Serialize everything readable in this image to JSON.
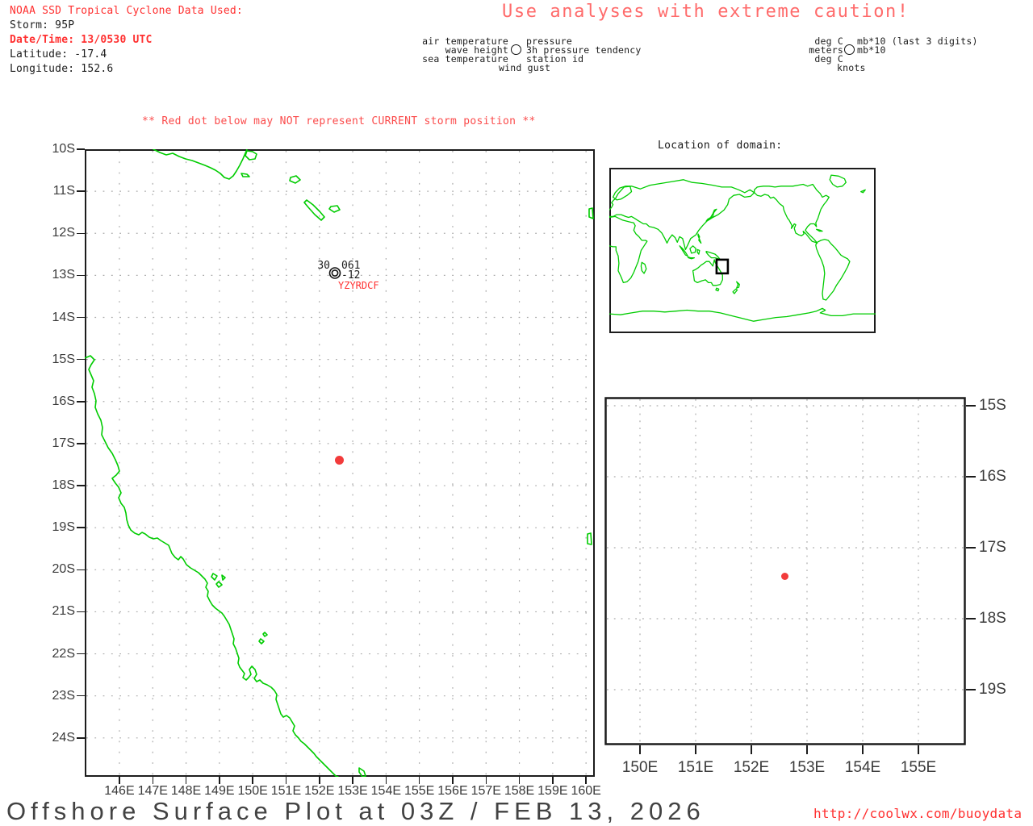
{
  "header": {
    "noaa_line": "NOAA SSD Tropical Cyclone Data Used:",
    "storm": "Storm: 95P",
    "datetime": "Date/Time: 13/0530 UTC",
    "latitude": "Latitude: -17.4",
    "longitude": "Longitude: 152.6",
    "caution": "Use analyses with extreme caution!"
  },
  "station_legend": {
    "air_temperature": "air temperature",
    "wave_height": "wave height",
    "sea_temperature": "sea temperature",
    "wind_gust": "wind gust",
    "pressure": "pressure",
    "pressure_tendency": "3h pressure tendency",
    "station_id": "station id"
  },
  "units_legend": {
    "air_temperature": "deg C",
    "wave_height": "meters",
    "sea_temperature": "deg C",
    "wind_gust": "knots",
    "pressure": "mb*10 (last 3 digits)",
    "pressure_tendency": "mb*10"
  },
  "warning": "** Red dot below may NOT represent CURRENT storm position **",
  "inset": {
    "title": "Location of domain:"
  },
  "main_map": {
    "lat_labels": [
      "10S",
      "11S",
      "12S",
      "13S",
      "14S",
      "15S",
      "16S",
      "17S",
      "18S",
      "19S",
      "20S",
      "21S",
      "22S",
      "23S",
      "24S"
    ],
    "lon_labels": [
      "146E",
      "147E",
      "148E",
      "149E",
      "150E",
      "151E",
      "152E",
      "153E",
      "154E",
      "155E",
      "156E",
      "157E",
      "158E",
      "159E",
      "160E"
    ],
    "station": {
      "air_temp": "30",
      "pressure": "061",
      "tendency": "-12",
      "station_id": "YZYRDCF"
    },
    "storm_dot": {
      "lat": -17.4,
      "lon": 152.6
    }
  },
  "zoom_map": {
    "lat_labels": [
      "15S",
      "16S",
      "17S",
      "18S",
      "19S"
    ],
    "lon_labels": [
      "150E",
      "151E",
      "152E",
      "153E",
      "154E",
      "155E"
    ],
    "storm_dot": {
      "lat": -17.4,
      "lon": 152.6
    }
  },
  "footer": {
    "title": "Offshore Surface Plot at 03Z / FEB 13, 2026",
    "url": "http://coolwx.com/buoydata"
  },
  "colors": {
    "coast_green": "#00cc00",
    "alert_red": "#ff3030",
    "caution_red": "#ff6b6b",
    "warning_red": "#fb4b4b",
    "grid_gray": "#aaaaaa",
    "frame_black": "#1c1c1c",
    "storm_dot_red": "#f23b3b"
  }
}
